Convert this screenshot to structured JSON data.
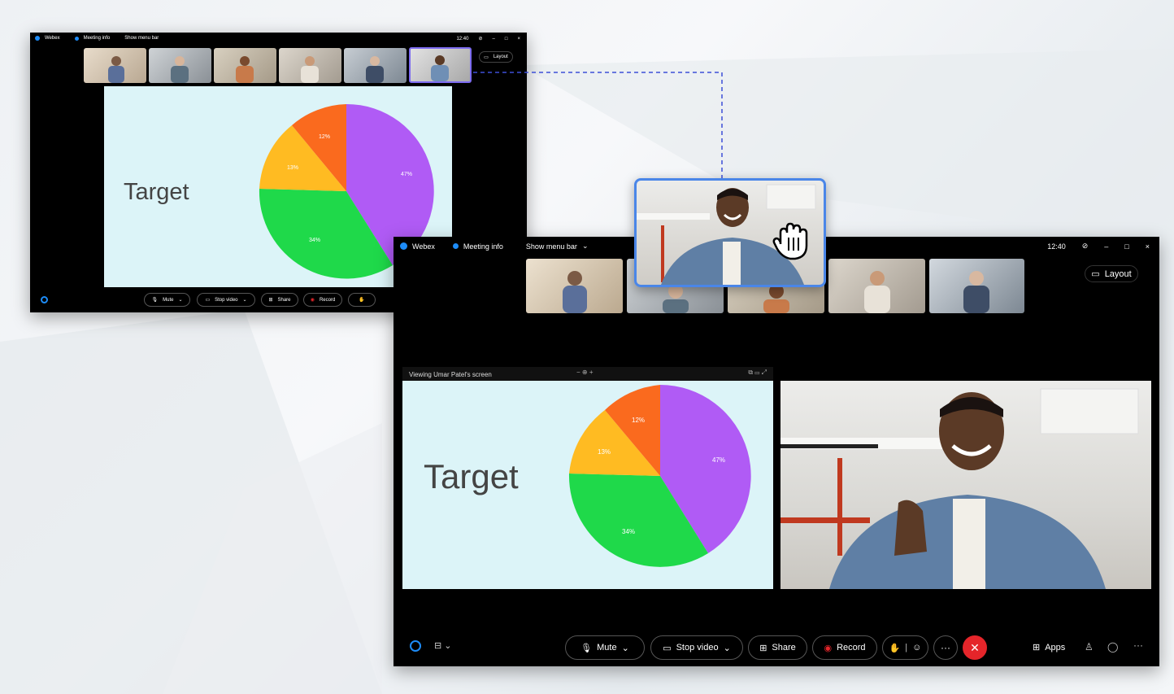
{
  "app_name": "Webex",
  "colors": {
    "accent": "#1d8cf8",
    "end_call": "#e5252a",
    "slide_bg": "#dcf4f8",
    "pie_purple": "#b05bf5",
    "pie_green": "#1fd94a",
    "pie_yellow": "#ffbb22",
    "pie_orange": "#fa6a1e",
    "drag_border": "#4a86e8"
  },
  "back_window": {
    "brand": "Webex",
    "meeting_info": "Meeting info",
    "menu_bar": "Show menu bar",
    "time": "12:40",
    "layout": "Layout",
    "slide_title": "Target",
    "pie_labels": [
      "47%",
      "34%",
      "13%",
      "12%"
    ],
    "controls": {
      "mute": "Mute",
      "stop_video": "Stop video",
      "share": "Share",
      "record": "Record"
    }
  },
  "front_window": {
    "brand": "Webex",
    "meeting_info": "Meeting info",
    "menu_bar": "Show menu bar",
    "time": "12:40",
    "layout": "Layout",
    "viewing": "Viewing Umar Patel's screen",
    "slide_title": "Target",
    "pie_labels": [
      "47%",
      "34%",
      "13%",
      "12%"
    ],
    "controls": {
      "mute": "Mute",
      "stop_video": "Stop video",
      "share": "Share",
      "record": "Record",
      "apps": "Apps"
    }
  },
  "icons": [
    "webex-logo-icon",
    "meeting-info-icon",
    "chevron-down-icon",
    "help-icon",
    "minimize-icon",
    "maximize-icon",
    "close-icon",
    "layout-icon",
    "microphone-icon",
    "video-icon",
    "share-icon",
    "record-icon",
    "raise-hand-icon",
    "reactions-icon",
    "more-icon",
    "end-call-icon",
    "apps-icon",
    "participants-icon",
    "chat-icon",
    "drag-hand-icon"
  ]
}
